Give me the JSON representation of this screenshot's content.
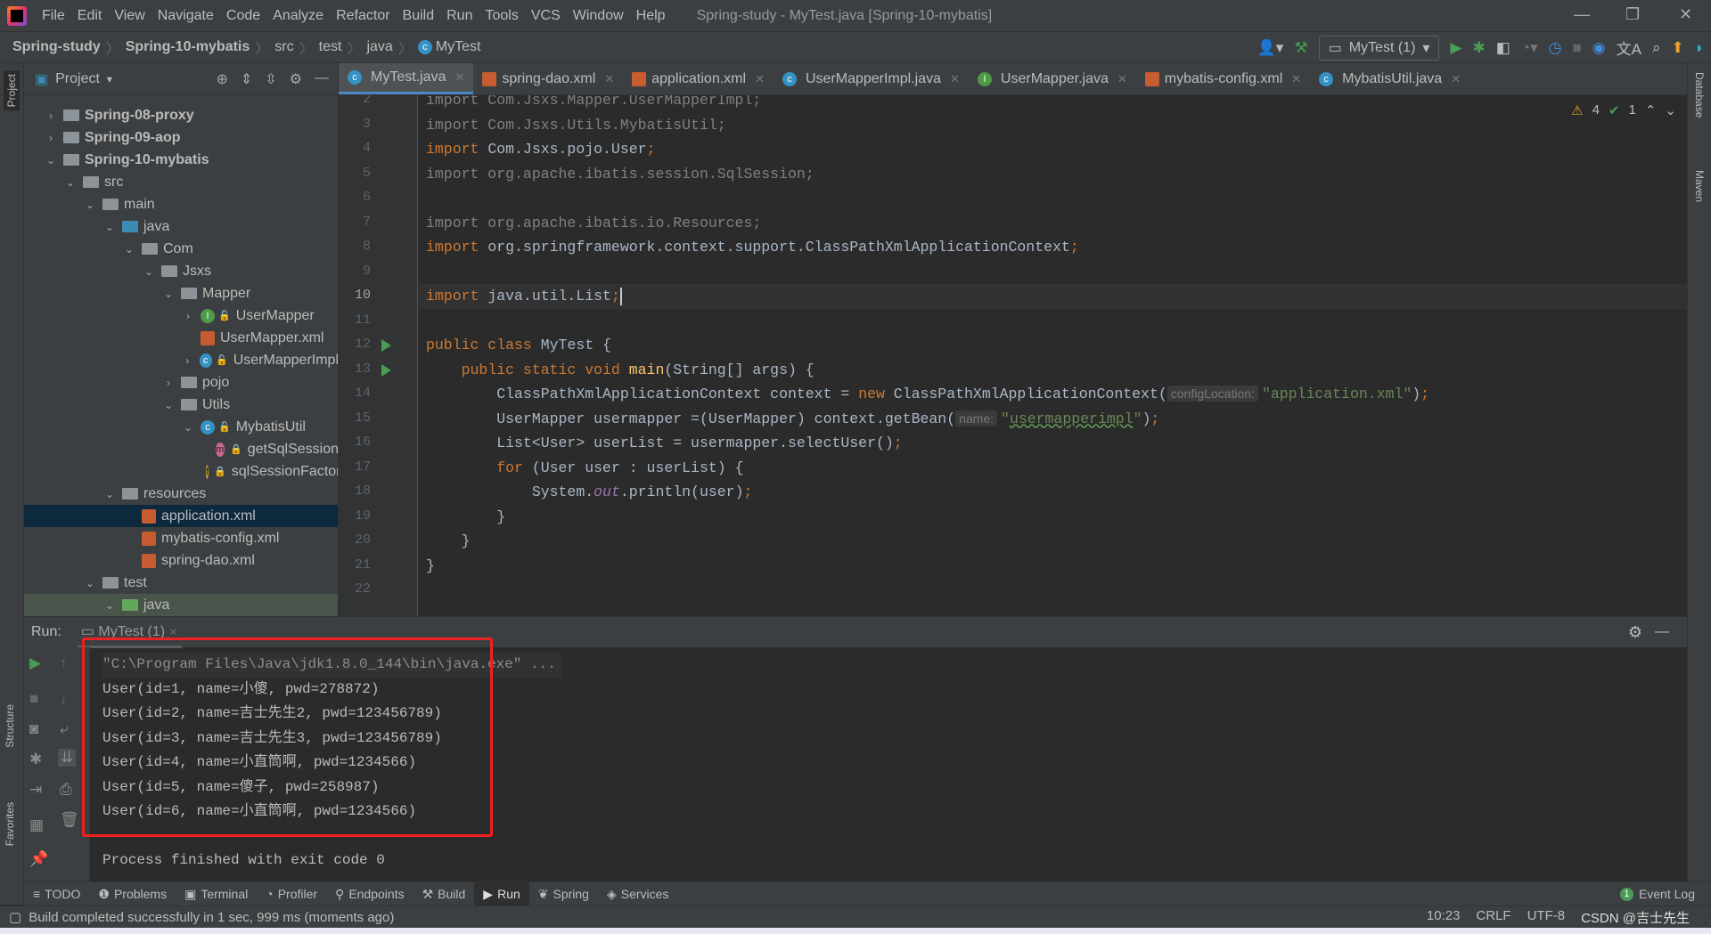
{
  "window": {
    "title": "Spring-study - MyTest.java [Spring-10-mybatis]",
    "menu": [
      "File",
      "Edit",
      "View",
      "Navigate",
      "Code",
      "Analyze",
      "Refactor",
      "Build",
      "Run",
      "Tools",
      "VCS",
      "Window",
      "Help"
    ]
  },
  "breadcrumb": [
    "Spring-study",
    "Spring-10-mybatis",
    "src",
    "test",
    "java",
    "MyTest"
  ],
  "toolbar": {
    "run_config": "MyTest (1)"
  },
  "left_strip": {
    "project": "Project",
    "structure": "Structure",
    "favorites": "Favorites"
  },
  "right_strip": {
    "database": "Database",
    "maven": "Maven"
  },
  "project": {
    "title": "Project",
    "tree": [
      {
        "label": "Spring-08-proxy",
        "depth": 0,
        "arrow": "›",
        "icon": "module",
        "bold": true
      },
      {
        "label": "Spring-09-aop",
        "depth": 0,
        "arrow": "›",
        "icon": "module",
        "bold": true
      },
      {
        "label": "Spring-10-mybatis",
        "depth": 0,
        "arrow": "⌄",
        "icon": "module",
        "bold": true
      },
      {
        "label": "src",
        "depth": 1,
        "arrow": "⌄",
        "icon": "folder"
      },
      {
        "label": "main",
        "depth": 2,
        "arrow": "⌄",
        "icon": "folder"
      },
      {
        "label": "java",
        "depth": 3,
        "arrow": "⌄",
        "icon": "folder-blue"
      },
      {
        "label": "Com",
        "depth": 4,
        "arrow": "⌄",
        "icon": "package"
      },
      {
        "label": "Jsxs",
        "depth": 5,
        "arrow": "⌄",
        "icon": "package"
      },
      {
        "label": "Mapper",
        "depth": 6,
        "arrow": "⌄",
        "icon": "package"
      },
      {
        "label": "UserMapper",
        "depth": 7,
        "arrow": "›",
        "icon": "interface"
      },
      {
        "label": "UserMapper.xml",
        "depth": 7,
        "arrow": "",
        "icon": "xml"
      },
      {
        "label": "UserMapperImpl",
        "depth": 7,
        "arrow": "›",
        "icon": "class"
      },
      {
        "label": "pojo",
        "depth": 6,
        "arrow": "›",
        "icon": "package"
      },
      {
        "label": "Utils",
        "depth": 6,
        "arrow": "⌄",
        "icon": "package"
      },
      {
        "label": "MybatisUtil",
        "depth": 7,
        "arrow": "⌄",
        "icon": "class"
      },
      {
        "label": "getSqlSession",
        "depth": 8,
        "arrow": "",
        "icon": "method"
      },
      {
        "label": "sqlSessionFactory",
        "depth": 8,
        "arrow": "",
        "icon": "field"
      },
      {
        "label": "resources",
        "depth": 3,
        "arrow": "⌄",
        "icon": "folder"
      },
      {
        "label": "application.xml",
        "depth": 4,
        "arrow": "",
        "icon": "xml",
        "selected": true
      },
      {
        "label": "mybatis-config.xml",
        "depth": 4,
        "arrow": "",
        "icon": "xml"
      },
      {
        "label": "spring-dao.xml",
        "depth": 4,
        "arrow": "",
        "icon": "xml"
      },
      {
        "label": "test",
        "depth": 2,
        "arrow": "⌄",
        "icon": "folder"
      },
      {
        "label": "java",
        "depth": 3,
        "arrow": "⌄",
        "icon": "folder-green",
        "test": true
      }
    ]
  },
  "tabs": [
    {
      "label": "MyTest.java",
      "icon": "class",
      "active": true
    },
    {
      "label": "spring-dao.xml",
      "icon": "xml"
    },
    {
      "label": "application.xml",
      "icon": "xml"
    },
    {
      "label": "UserMapperImpl.java",
      "icon": "class"
    },
    {
      "label": "UserMapper.java",
      "icon": "interface"
    },
    {
      "label": "mybatis-config.xml",
      "icon": "xml"
    },
    {
      "label": "MybatisUtil.java",
      "icon": "class"
    }
  ],
  "editor": {
    "warnings": "4",
    "checks": "1",
    "current_line": 10,
    "run_lines": [
      12,
      13
    ],
    "lines": [
      {
        "n": 2,
        "t": [
          [
            "d",
            "import Com.Jsxs.Mapper.UserMapperImpl;"
          ]
        ]
      },
      {
        "n": 3,
        "t": [
          [
            "d",
            "import Com.Jsxs.Utils.MybatisUtil;"
          ]
        ]
      },
      {
        "n": 4,
        "t": [
          [
            "k",
            "import "
          ],
          [
            "p",
            "Com.Jsxs.pojo.User"
          ],
          [
            "k",
            ";"
          ]
        ]
      },
      {
        "n": 5,
        "t": [
          [
            "d",
            "import org.apache.ibatis.session.SqlSession;"
          ]
        ]
      },
      {
        "n": 6,
        "t": []
      },
      {
        "n": 7,
        "t": [
          [
            "d",
            "import org.apache.ibatis.io.Resources;"
          ]
        ]
      },
      {
        "n": 8,
        "t": [
          [
            "k",
            "import "
          ],
          [
            "p",
            "org.springframework.context.support.ClassPathXmlApplicationContext"
          ],
          [
            "k",
            ";"
          ]
        ]
      },
      {
        "n": 9,
        "t": []
      },
      {
        "n": 10,
        "t": [
          [
            "k",
            "import "
          ],
          [
            "p",
            "java.util.List"
          ],
          [
            "k",
            ";"
          ],
          [
            "caret",
            ""
          ]
        ]
      },
      {
        "n": 11,
        "t": []
      },
      {
        "n": 12,
        "t": [
          [
            "k",
            "public class "
          ],
          [
            "p",
            "MyTest {"
          ]
        ]
      },
      {
        "n": 13,
        "t": [
          [
            "p",
            "    "
          ],
          [
            "k",
            "public static void "
          ],
          [
            "m",
            "main"
          ],
          [
            "p",
            "(String[] args) {"
          ]
        ]
      },
      {
        "n": 14,
        "t": [
          [
            "p",
            "        ClassPathXmlApplicationContext context = "
          ],
          [
            "k",
            "new "
          ],
          [
            "p",
            "ClassPathXmlApplicationContext("
          ],
          [
            "hint",
            "configLocation:"
          ],
          [
            "s",
            "\"application.xml\""
          ],
          [
            "p",
            ")"
          ],
          [
            "k",
            ";"
          ]
        ]
      },
      {
        "n": 15,
        "t": [
          [
            "p",
            "        UserMapper usermapper =(UserMapper) context.getBean("
          ],
          [
            "hint",
            "name:"
          ],
          [
            "s",
            "\""
          ],
          [
            "su",
            "usermapperimpl"
          ],
          [
            "s",
            "\""
          ],
          [
            "p",
            ")"
          ],
          [
            "k",
            ";"
          ]
        ]
      },
      {
        "n": 16,
        "t": [
          [
            "p",
            "        List<User> userList = usermapper.selectUser()"
          ],
          [
            "k",
            ";"
          ]
        ]
      },
      {
        "n": 17,
        "t": [
          [
            "p",
            "        "
          ],
          [
            "k",
            "for "
          ],
          [
            "p",
            "(User user : userList) {"
          ]
        ]
      },
      {
        "n": 18,
        "t": [
          [
            "p",
            "            System."
          ],
          [
            "f",
            "out"
          ],
          [
            "p",
            ".println(user)"
          ],
          [
            "k",
            ";"
          ]
        ]
      },
      {
        "n": 19,
        "t": [
          [
            "p",
            "        }"
          ]
        ]
      },
      {
        "n": 20,
        "t": [
          [
            "p",
            "    }"
          ]
        ]
      },
      {
        "n": 21,
        "t": [
          [
            "p",
            "}"
          ]
        ]
      },
      {
        "n": 22,
        "t": []
      }
    ]
  },
  "run": {
    "label": "Run:",
    "tab": "MyTest (1)",
    "output": [
      "\"C:\\Program Files\\Java\\jdk1.8.0_144\\bin\\java.exe\" ...",
      "User(id=1, name=小傻, pwd=278872)",
      "User(id=2, name=吉士先生2, pwd=123456789)",
      "User(id=3, name=吉士先生3, pwd=123456789)",
      "User(id=4, name=小直筒啊, pwd=1234566)",
      "User(id=5, name=傻子, pwd=258987)",
      "User(id=6, name=小直筒啊, pwd=1234566)",
      "",
      "Process finished with exit code 0"
    ]
  },
  "bottom_tabs": [
    {
      "label": "TODO",
      "icon": "≡"
    },
    {
      "label": "Problems",
      "icon": "❶"
    },
    {
      "label": "Terminal",
      "icon": "▣"
    },
    {
      "label": "Profiler",
      "icon": "◔"
    },
    {
      "label": "Endpoints",
      "icon": "⚲"
    },
    {
      "label": "Build",
      "icon": "⚒"
    },
    {
      "label": "Run",
      "icon": "▶",
      "active": true
    },
    {
      "label": "Spring",
      "icon": "❦"
    },
    {
      "label": "Services",
      "icon": "◈"
    }
  ],
  "event_log": {
    "label": "Event Log",
    "count": "1"
  },
  "status": {
    "message": "Build completed successfully in 1 sec, 999 ms (moments ago)",
    "position": "10:23",
    "line_sep": "CRLF",
    "encoding": "UTF-8",
    "watermark": "CSDN @吉士先生"
  },
  "colors": {
    "keyword": "#cc7832",
    "string": "#6a8759",
    "highlight_box": "#ee2020",
    "selection": "#0d293e"
  }
}
